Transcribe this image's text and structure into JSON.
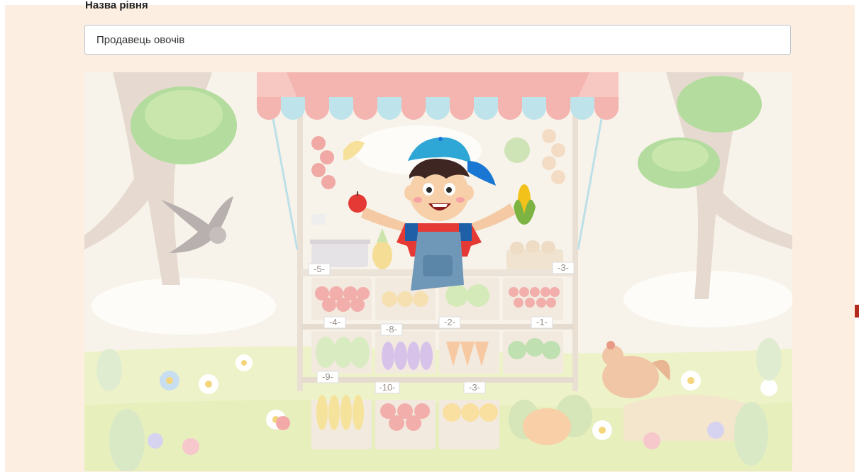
{
  "level_form": {
    "label": "Назва рівня",
    "name_value": "Продавець овочів"
  },
  "scene": {
    "price_tags": [
      "-5-",
      "-3-",
      "-4-",
      "-8-",
      "-2-",
      "-1-",
      "-9-",
      "-10-",
      "-3-"
    ]
  },
  "colors": {
    "panel_bg": "#fcefe2",
    "marker": "#b22a1c"
  }
}
